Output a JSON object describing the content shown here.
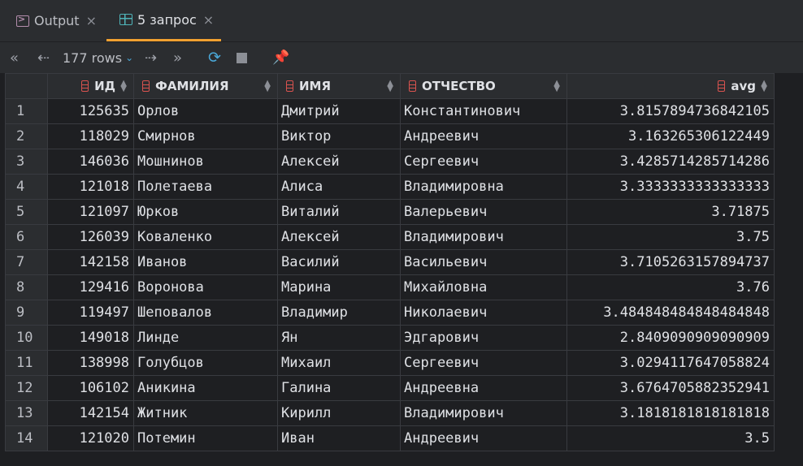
{
  "tabs": [
    {
      "label": "Output",
      "icon": "terminal-icon"
    },
    {
      "label": "5 запрос",
      "icon": "table-icon",
      "active": true
    }
  ],
  "toolbar": {
    "rows_label": "177 rows"
  },
  "columns": [
    "ИД",
    "ФАМИЛИЯ",
    "ИМЯ",
    "ОТЧЕСТВО",
    "avg"
  ],
  "rows": [
    {
      "n": "1",
      "id": "125635",
      "last": "Орлов",
      "first": "Дмитрий",
      "middle": "Константинович",
      "avg": "3.8157894736842105"
    },
    {
      "n": "2",
      "id": "118029",
      "last": "Смирнов",
      "first": "Виктор",
      "middle": "Андреевич",
      "avg": "3.163265306122449"
    },
    {
      "n": "3",
      "id": "146036",
      "last": "Мошнинов",
      "first": "Алексей",
      "middle": "Сергеевич",
      "avg": "3.4285714285714286"
    },
    {
      "n": "4",
      "id": "121018",
      "last": "Полетаева",
      "first": "Алиса",
      "middle": "Владимировна",
      "avg": "3.3333333333333333"
    },
    {
      "n": "5",
      "id": "121097",
      "last": "Юрков",
      "first": "Виталий",
      "middle": "Валерьевич",
      "avg": "3.71875"
    },
    {
      "n": "6",
      "id": "126039",
      "last": "Коваленко",
      "first": "Алексей",
      "middle": "Владимирович",
      "avg": "3.75"
    },
    {
      "n": "7",
      "id": "142158",
      "last": "Иванов",
      "first": "Василий",
      "middle": "Васильевич",
      "avg": "3.7105263157894737"
    },
    {
      "n": "8",
      "id": "129416",
      "last": "Воронова",
      "first": "Марина",
      "middle": "Михайловна",
      "avg": "3.76"
    },
    {
      "n": "9",
      "id": "119497",
      "last": "Шеповалов",
      "first": "Владимир",
      "middle": "Николаевич",
      "avg": "3.484848484848484848"
    },
    {
      "n": "10",
      "id": "149018",
      "last": "Линде",
      "first": "Ян",
      "middle": "Эдгарович",
      "avg": "2.8409090909090909"
    },
    {
      "n": "11",
      "id": "138998",
      "last": "Голубцов",
      "first": "Михаил",
      "middle": "Сергеевич",
      "avg": "3.0294117647058824"
    },
    {
      "n": "12",
      "id": "106102",
      "last": "Аникина",
      "first": "Галина",
      "middle": "Андреевна",
      "avg": "3.6764705882352941"
    },
    {
      "n": "13",
      "id": "142154",
      "last": "Житник",
      "first": "Кирилл",
      "middle": "Владимирович",
      "avg": "3.1818181818181818"
    },
    {
      "n": "14",
      "id": "121020",
      "last": "Потемин",
      "first": "Иван",
      "middle": "Андреевич",
      "avg": "3.5"
    }
  ]
}
